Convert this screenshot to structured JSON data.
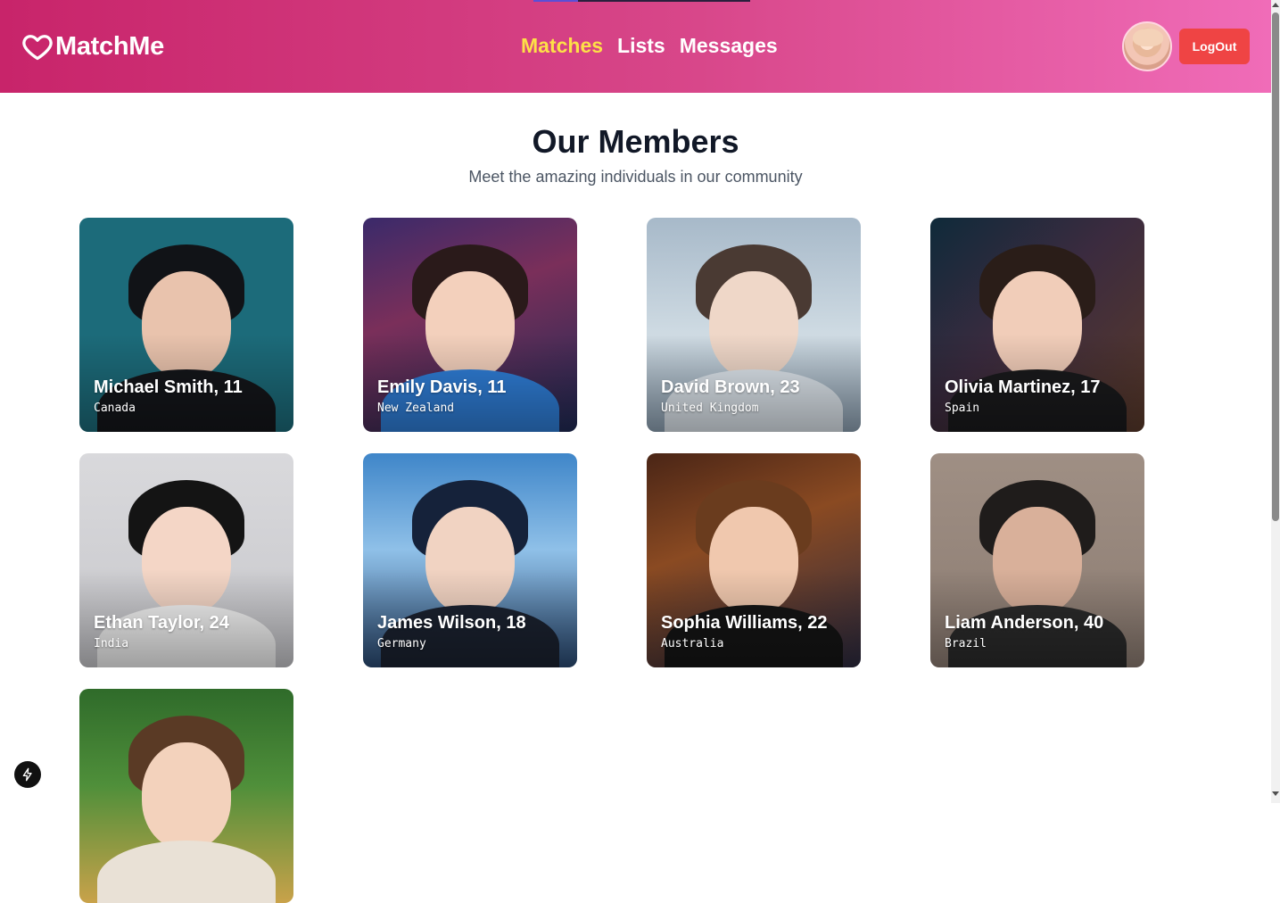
{
  "header": {
    "brand": "MatchMe",
    "nav": [
      {
        "label": "Matches",
        "active": true
      },
      {
        "label": "Lists",
        "active": false
      },
      {
        "label": "Messages",
        "active": false
      }
    ],
    "logout_label": "LogOut"
  },
  "page": {
    "title": "Our Members",
    "subtitle": "Meet the amazing individuals in our community"
  },
  "members": [
    {
      "name": "Michael Smith, 11",
      "place": "Canada"
    },
    {
      "name": "Emily Davis, 11",
      "place": "New Zealand"
    },
    {
      "name": "David Brown, 23",
      "place": "United Kingdom"
    },
    {
      "name": "Olivia Martinez, 17",
      "place": "Spain"
    },
    {
      "name": "Ethan Taylor, 24",
      "place": "India"
    },
    {
      "name": "James Wilson, 18",
      "place": "Germany"
    },
    {
      "name": "Sophia Williams, 22",
      "place": "Australia"
    },
    {
      "name": "Liam Anderson, 40",
      "place": "Brazil"
    },
    {
      "name": "",
      "place": ""
    }
  ],
  "colors": {
    "header_start": "#c8246a",
    "header_end": "#f06cb8",
    "active_nav": "#fde047",
    "logout": "#ef4444"
  },
  "icons": {
    "brand": "heart-outline-icon",
    "devtools": "lightning-icon"
  }
}
